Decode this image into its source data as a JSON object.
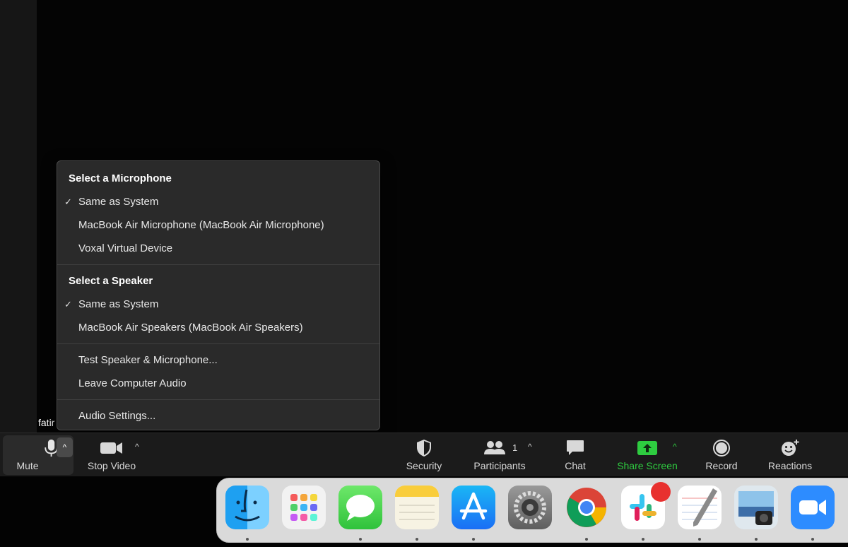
{
  "meeting": {
    "participant_name": "fatir"
  },
  "audio_menu": {
    "microphone_heading": "Select a Microphone",
    "microphones": [
      {
        "label": "Same as System",
        "selected": true
      },
      {
        "label": "MacBook Air Microphone (MacBook Air Microphone)",
        "selected": false
      },
      {
        "label": "Voxal Virtual Device",
        "selected": false
      }
    ],
    "speaker_heading": "Select a Speaker",
    "speakers": [
      {
        "label": "Same as System",
        "selected": true
      },
      {
        "label": "MacBook Air Speakers (MacBook Air Speakers)",
        "selected": false
      }
    ],
    "test_label": "Test Speaker & Microphone...",
    "leave_label": "Leave Computer Audio",
    "settings_label": "Audio Settings...",
    "check_glyph": "✓"
  },
  "toolbar": {
    "mute_label": "Mute",
    "stop_video_label": "Stop Video",
    "security_label": "Security",
    "participants_label": "Participants",
    "participants_count": "1",
    "chat_label": "Chat",
    "share_screen_label": "Share Screen",
    "record_label": "Record",
    "reactions_label": "Reactions",
    "caret_glyph": "^"
  },
  "colors": {
    "share_green": "#2ecc40",
    "menu_bg": "#2a2a2a",
    "toolbar_bg": "#1b1b1b",
    "badge_red": "#e8312f"
  },
  "dock": {
    "apps": [
      {
        "name": "finder-icon",
        "running": true
      },
      {
        "name": "launchpad-icon",
        "running": false
      },
      {
        "name": "messages-icon",
        "running": true
      },
      {
        "name": "notes-icon",
        "running": true
      },
      {
        "name": "app-store-icon",
        "running": true
      },
      {
        "name": "system-preferences-icon",
        "running": false
      },
      {
        "name": "chrome-icon",
        "running": true
      },
      {
        "name": "slack-icon",
        "running": true
      },
      {
        "name": "textedit-icon",
        "running": true
      },
      {
        "name": "preview-icon",
        "running": true
      },
      {
        "name": "zoom-icon",
        "running": true
      }
    ]
  }
}
